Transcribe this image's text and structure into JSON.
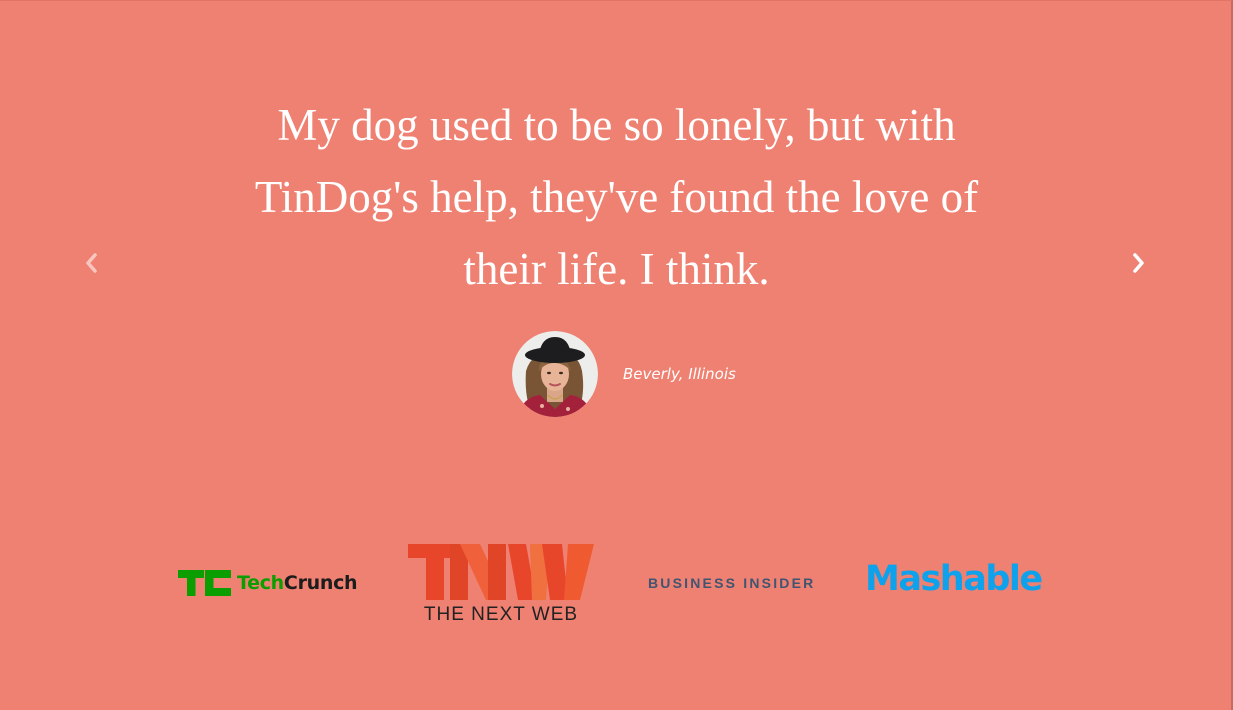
{
  "testimonial": {
    "quote": "My dog used to be so lonely, but with TinDog's help, they've found the love of their life. I think.",
    "author": "Beverly, Illinois"
  },
  "carousel": {
    "prev_icon": "chevron-left-icon",
    "next_icon": "chevron-right-icon"
  },
  "press": {
    "techcrunch": {
      "mark": "TC",
      "word_green": "Tech",
      "word_dark": "Crunch",
      "color": "#0a9e01"
    },
    "tnw": {
      "mark": "TNW",
      "tagline": "THE NEXT WEB",
      "color": "#e8462b"
    },
    "business_insider": {
      "name": "BUSINESS INSIDER",
      "color": "#3f5571"
    },
    "mashable": {
      "name": "Mashable",
      "color": "#0ea1ec"
    }
  },
  "colors": {
    "background": "#ef8172",
    "text": "#ffffff"
  }
}
